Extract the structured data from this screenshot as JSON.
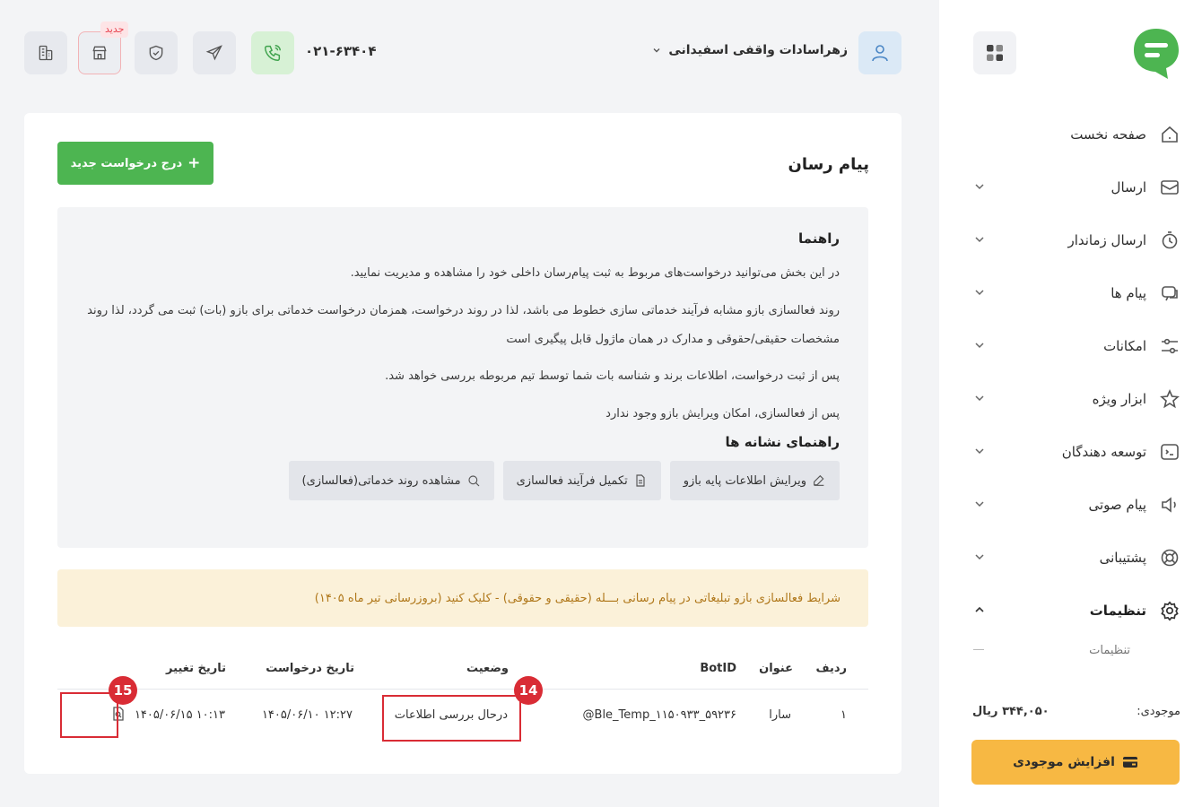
{
  "sidebar": {
    "apps_button": "apps-grid-icon",
    "items": [
      {
        "label": "صفحه نخست",
        "icon": "home-icon",
        "expandable": false
      },
      {
        "label": "ارسال",
        "icon": "send-inbox-icon",
        "expandable": true
      },
      {
        "label": "ارسال زماندار",
        "icon": "timer-icon",
        "expandable": true
      },
      {
        "label": "پیام ها",
        "icon": "messages-icon",
        "expandable": true
      },
      {
        "label": "امکانات",
        "icon": "sliders-icon",
        "expandable": true
      },
      {
        "label": "ابزار ویژه",
        "icon": "star-icon",
        "expandable": true
      },
      {
        "label": "توسعه دهندگان",
        "icon": "code-icon",
        "expandable": true
      },
      {
        "label": "پیام صوتی",
        "icon": "speaker-icon",
        "expandable": true
      },
      {
        "label": "پشتیبانی",
        "icon": "lifebuoy-icon",
        "expandable": true
      },
      {
        "label": "تنظیمات",
        "icon": "gear-icon",
        "expandable": true,
        "expanded": true
      }
    ],
    "sub_items": [
      "تنظیمات"
    ],
    "balance_label": "موجودی:",
    "balance_value": "۳۴۴,۰۵۰ ریال",
    "topup_label": "افزایش موجودی"
  },
  "topbar": {
    "user_name": "زهراسادات واقفی اسفیدانی",
    "phone": "۰۲۱-۶۳۴۰۴",
    "new_badge": "جدید"
  },
  "page": {
    "title": "پیام رسان",
    "new_request": "درج درخواست جدید",
    "guide_title": "راهنما",
    "guide_paragraphs": [
      "در این بخش می‌توانید درخواست‌های مربوط به ثبت پیام‌رسان داخلی خود را مشاهده و مدیریت نمایید.",
      "روند فعالسازی بازو مشابه فرآیند خدماتی سازی خطوط می باشد، لذا در روند درخواست، همزمان درخواست خدماتی برای بازو (بات) ثبت می گردد، لذا روند مشخصات حقیقی/حقوقی و مدارک در همان ماژول قابل پیگیری است",
      "پس از ثبت درخواست، اطلاعات برند و شناسه بات شما توسط تیم مربوطه بررسی خواهد شد.",
      "پس از فعالسازی، امکان ویرایش بازو وجود ندارد"
    ],
    "legend_title": "راهنمای نشانه ها",
    "legend": [
      {
        "label": "ویرایش اطلاعات پایه بازو",
        "icon": "edit-icon"
      },
      {
        "label": "تکمیل فرآیند فعالسازی",
        "icon": "document-icon"
      },
      {
        "label": "مشاهده روند خدماتی(فعالسازی)",
        "icon": "search-icon"
      }
    ],
    "notice": "شرایط فعالسازی بازو تبلیغاتی در پیام رسانی بـــله (حقیقی و حقوقی) - کلیک کنید (بروزرسانی تیر ماه ۱۴۰۵)"
  },
  "table": {
    "headers": {
      "row": "ردیف",
      "title": "عنوان",
      "bot_id": "BotID",
      "status": "وضعیت",
      "request_date": "تاریخ درخواست",
      "change_date": "تاریخ تغییر"
    },
    "rows": [
      {
        "row": "۱",
        "title": "سارا",
        "bot_id": "@Ble_Temp_۱۱۵۰۹۳۳_۵۹۲۳۶",
        "status": "درحال بررسی اطلاعات",
        "request_date": "۱۴۰۵/۰۶/۱۰ ۱۲:۲۷",
        "change_date": "۱۴۰۵/۰۶/۱۵ ۱۰:۱۳",
        "action_icon": "search-document-icon"
      }
    ]
  },
  "annotations": {
    "status_marker": "14",
    "action_marker": "15"
  },
  "colors": {
    "primary_green": "#4db551",
    "accent_yellow": "#f7b843",
    "notice_bg": "#fbf1d9",
    "marker_red": "#d92c35"
  }
}
